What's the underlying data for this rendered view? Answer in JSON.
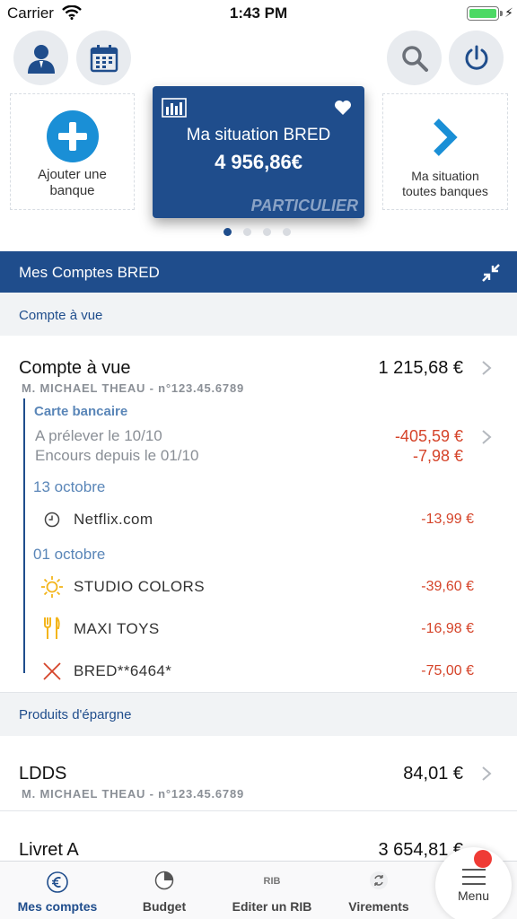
{
  "status_bar": {
    "carrier": "Carrier",
    "time": "1:43 PM"
  },
  "header": {
    "profile_icon": "user-icon",
    "calendar_icon": "calendar-icon",
    "search_icon": "search-icon",
    "power_icon": "power-icon"
  },
  "cards": {
    "add_bank": {
      "label_line1": "Ajouter une",
      "label_line2": "banque",
      "icon": "plus-icon"
    },
    "main": {
      "title": "Ma situation BRED",
      "amount": "4 956,86€",
      "tag": "PARTICULIER",
      "chart_icon": "bar-chart-icon",
      "fav_icon": "heart-icon"
    },
    "all_banks": {
      "label_line1": "Ma situation",
      "label_line2": "toutes banques",
      "icon": "chevron-right-icon"
    },
    "pager": {
      "count": 4,
      "active_index": 0
    }
  },
  "accounts_bar": {
    "title": "Mes Comptes BRED"
  },
  "groups": {
    "current": {
      "title": "Compte à vue"
    },
    "savings": {
      "title": "Produits d'épargne"
    }
  },
  "current_account": {
    "name": "Compte à vue",
    "amount": "1 215,68 €",
    "owner": "M. MICHAEL THEAU - n°123.45.6789",
    "card": {
      "label": "Carte bancaire",
      "pending_label": "A prélever le 10/10",
      "pending_amount": "-405,59 €",
      "encours_label": "Encours depuis le 01/10",
      "encours_amount": "-7,98 €"
    },
    "dates": {
      "d1": "13 octobre",
      "d2": "01 octobre"
    },
    "transactions": [
      {
        "label": "Netflix.com",
        "amount": "-13,99 €",
        "icon": "clock-icon"
      },
      {
        "label": "STUDIO COLORS",
        "amount": "-39,60 €",
        "icon": "sun-icon"
      },
      {
        "label": "MAXI TOYS",
        "amount": "-16,98 €",
        "icon": "utensils-icon"
      },
      {
        "label": "BRED**6464*",
        "amount": "-75,00 €",
        "icon": "cross-icon"
      }
    ]
  },
  "ldds": {
    "name": "LDDS",
    "amount": "84,01 €",
    "owner": "M. MICHAEL THEAU - n°123.45.6789"
  },
  "livret": {
    "name": "Livret A",
    "amount": "3 654,81 €"
  },
  "tabs": [
    {
      "label": "Mes comptes",
      "icon": "euro-icon"
    },
    {
      "label": "Budget",
      "icon": "pie-chart-icon"
    },
    {
      "label": "Editer un RIB",
      "icon": "rib-icon"
    },
    {
      "label": "Virements",
      "icon": "transfer-icon"
    }
  ],
  "menu": {
    "label": "Menu"
  },
  "colors": {
    "brand": "#1f4d8c",
    "debit": "#d5442a",
    "accent_light": "#5a86b8"
  }
}
